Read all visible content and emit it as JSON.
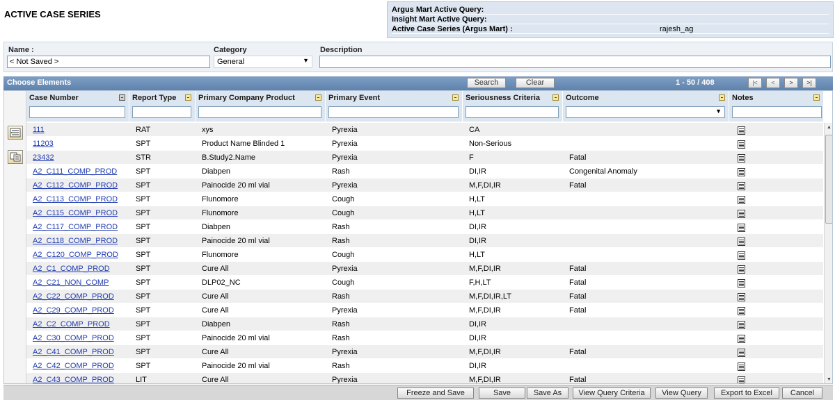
{
  "page_title": "ACTIVE CASE SERIES",
  "query_panel": {
    "argus_label": "Argus Mart Active Query:",
    "argus_value": "",
    "insight_label": "Insight Mart Active Query:",
    "insight_value": "",
    "series_label": "Active Case Series (Argus Mart) :",
    "series_value": "rajesh_ag"
  },
  "form": {
    "name_label": "Name :",
    "name_value": "< Not Saved >",
    "category_label": "Category",
    "category_value": "General",
    "description_label": "Description",
    "description_value": ""
  },
  "grid_bar": {
    "title": "Choose Elements",
    "search_label": "Search",
    "clear_label": "Clear",
    "pager_text": "1 - 50 / 408",
    "first_label": "|<",
    "prev_label": "<",
    "next_label": ">",
    "last_label": ">|"
  },
  "columns": {
    "case_number": "Case Number",
    "report_type": "Report Type",
    "product": "Primary Company Product",
    "event": "Primary Event",
    "seriousness": "Seriousness Criteria",
    "outcome": "Outcome",
    "notes": "Notes"
  },
  "rows": [
    {
      "case": "111",
      "report": "RAT",
      "product": "xys",
      "event": "Pyrexia",
      "seriousness": "CA",
      "outcome": ""
    },
    {
      "case": "11203",
      "report": "SPT",
      "product": "Product Name Blinded 1",
      "event": "Pyrexia",
      "seriousness": "Non-Serious",
      "outcome": ""
    },
    {
      "case": "23432",
      "report": "STR",
      "product": "B.Study2.Name",
      "event": "Pyrexia",
      "seriousness": "F",
      "outcome": "Fatal"
    },
    {
      "case": "A2_C111_COMP_PROD",
      "report": "SPT",
      "product": "Diabpen",
      "event": "Rash",
      "seriousness": "DI,IR",
      "outcome": "Congenital Anomaly"
    },
    {
      "case": "A2_C112_COMP_PROD",
      "report": "SPT",
      "product": "Painocide 20 ml vial",
      "event": "Pyrexia",
      "seriousness": "M,F,DI,IR",
      "outcome": "Fatal"
    },
    {
      "case": "A2_C113_COMP_PROD",
      "report": "SPT",
      "product": "Flunomore",
      "event": "Cough",
      "seriousness": "H,LT",
      "outcome": ""
    },
    {
      "case": "A2_C115_COMP_PROD",
      "report": "SPT",
      "product": "Flunomore",
      "event": "Cough",
      "seriousness": "H,LT",
      "outcome": ""
    },
    {
      "case": "A2_C117_COMP_PROD",
      "report": "SPT",
      "product": "Diabpen",
      "event": "Rash",
      "seriousness": "DI,IR",
      "outcome": ""
    },
    {
      "case": "A2_C118_COMP_PROD",
      "report": "SPT",
      "product": "Painocide 20 ml vial",
      "event": "Rash",
      "seriousness": "DI,IR",
      "outcome": ""
    },
    {
      "case": "A2_C120_COMP_PROD",
      "report": "SPT",
      "product": "Flunomore",
      "event": "Cough",
      "seriousness": "H,LT",
      "outcome": ""
    },
    {
      "case": "A2_C1_COMP_PROD",
      "report": "SPT",
      "product": "Cure All",
      "event": "Pyrexia",
      "seriousness": "M,F,DI,IR",
      "outcome": "Fatal"
    },
    {
      "case": "A2_C21_NON_COMP",
      "report": "SPT",
      "product": "DLP02_NC",
      "event": "Cough",
      "seriousness": "F,H,LT",
      "outcome": "Fatal"
    },
    {
      "case": "A2_C22_COMP_PROD",
      "report": "SPT",
      "product": "Cure All",
      "event": "Rash",
      "seriousness": "M,F,DI,IR,LT",
      "outcome": "Fatal"
    },
    {
      "case": "A2_C29_COMP_PROD",
      "report": "SPT",
      "product": "Cure All",
      "event": "Pyrexia",
      "seriousness": "M,F,DI,IR",
      "outcome": "Fatal"
    },
    {
      "case": "A2_C2_COMP_PROD",
      "report": "SPT",
      "product": "Diabpen",
      "event": "Rash",
      "seriousness": "DI,IR",
      "outcome": ""
    },
    {
      "case": "A2_C30_COMP_PROD",
      "report": "SPT",
      "product": "Painocide 20 ml vial",
      "event": "Rash",
      "seriousness": "DI,IR",
      "outcome": ""
    },
    {
      "case": "A2_C41_COMP_PROD",
      "report": "SPT",
      "product": "Cure All",
      "event": "Pyrexia",
      "seriousness": "M,F,DI,IR",
      "outcome": "Fatal"
    },
    {
      "case": "A2_C42_COMP_PROD",
      "report": "SPT",
      "product": "Painocide 20 ml vial",
      "event": "Rash",
      "seriousness": "DI,IR",
      "outcome": ""
    },
    {
      "case": "A2_C43_COMP_PROD",
      "report": "LIT",
      "product": "Cure All",
      "event": "Pyrexia",
      "seriousness": "M,F,DI,IR",
      "outcome": "Fatal"
    }
  ],
  "footer": {
    "freeze_save": "Freeze and Save",
    "save": "Save",
    "save_as": "Save As",
    "view_query_criteria": "View Query Criteria",
    "view_query": "View Query",
    "export_excel": "Export to Excel",
    "cancel": "Cancel"
  }
}
